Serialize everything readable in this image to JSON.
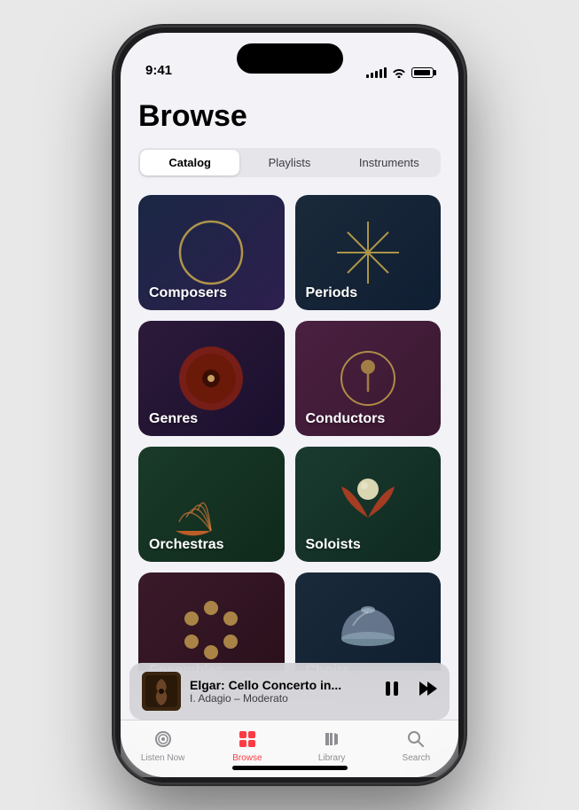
{
  "status": {
    "time": "9:41",
    "signal_bars": [
      3,
      5,
      7,
      9,
      11
    ],
    "wifi": true,
    "battery_level": 80
  },
  "page": {
    "title": "Browse"
  },
  "segments": {
    "items": [
      {
        "id": "catalog",
        "label": "Catalog",
        "active": true
      },
      {
        "id": "playlists",
        "label": "Playlists",
        "active": false
      },
      {
        "id": "instruments",
        "label": "Instruments",
        "active": false
      }
    ]
  },
  "grid": {
    "items": [
      {
        "id": "composers",
        "label": "Composers",
        "class": "item-composers"
      },
      {
        "id": "periods",
        "label": "Periods",
        "class": "item-periods"
      },
      {
        "id": "genres",
        "label": "Genres",
        "class": "item-genres"
      },
      {
        "id": "conductors",
        "label": "Conductors",
        "class": "item-conductors"
      },
      {
        "id": "orchestras",
        "label": "Orchestras",
        "class": "item-orchestras"
      },
      {
        "id": "soloists",
        "label": "Soloists",
        "class": "item-soloists"
      },
      {
        "id": "ensembles",
        "label": "Ensembles",
        "class": "item-ensembles"
      },
      {
        "id": "choirs",
        "label": "Choirs",
        "class": "item-choirs"
      }
    ]
  },
  "now_playing": {
    "title": "Elgar: Cello Concerto in...",
    "subtitle": "I. Adagio – Moderato",
    "art_emoji": "🎻"
  },
  "tabs": [
    {
      "id": "listen-now",
      "label": "Listen Now",
      "active": false
    },
    {
      "id": "browse",
      "label": "Browse",
      "active": true
    },
    {
      "id": "library",
      "label": "Library",
      "active": false
    },
    {
      "id": "search",
      "label": "Search",
      "active": false
    }
  ]
}
